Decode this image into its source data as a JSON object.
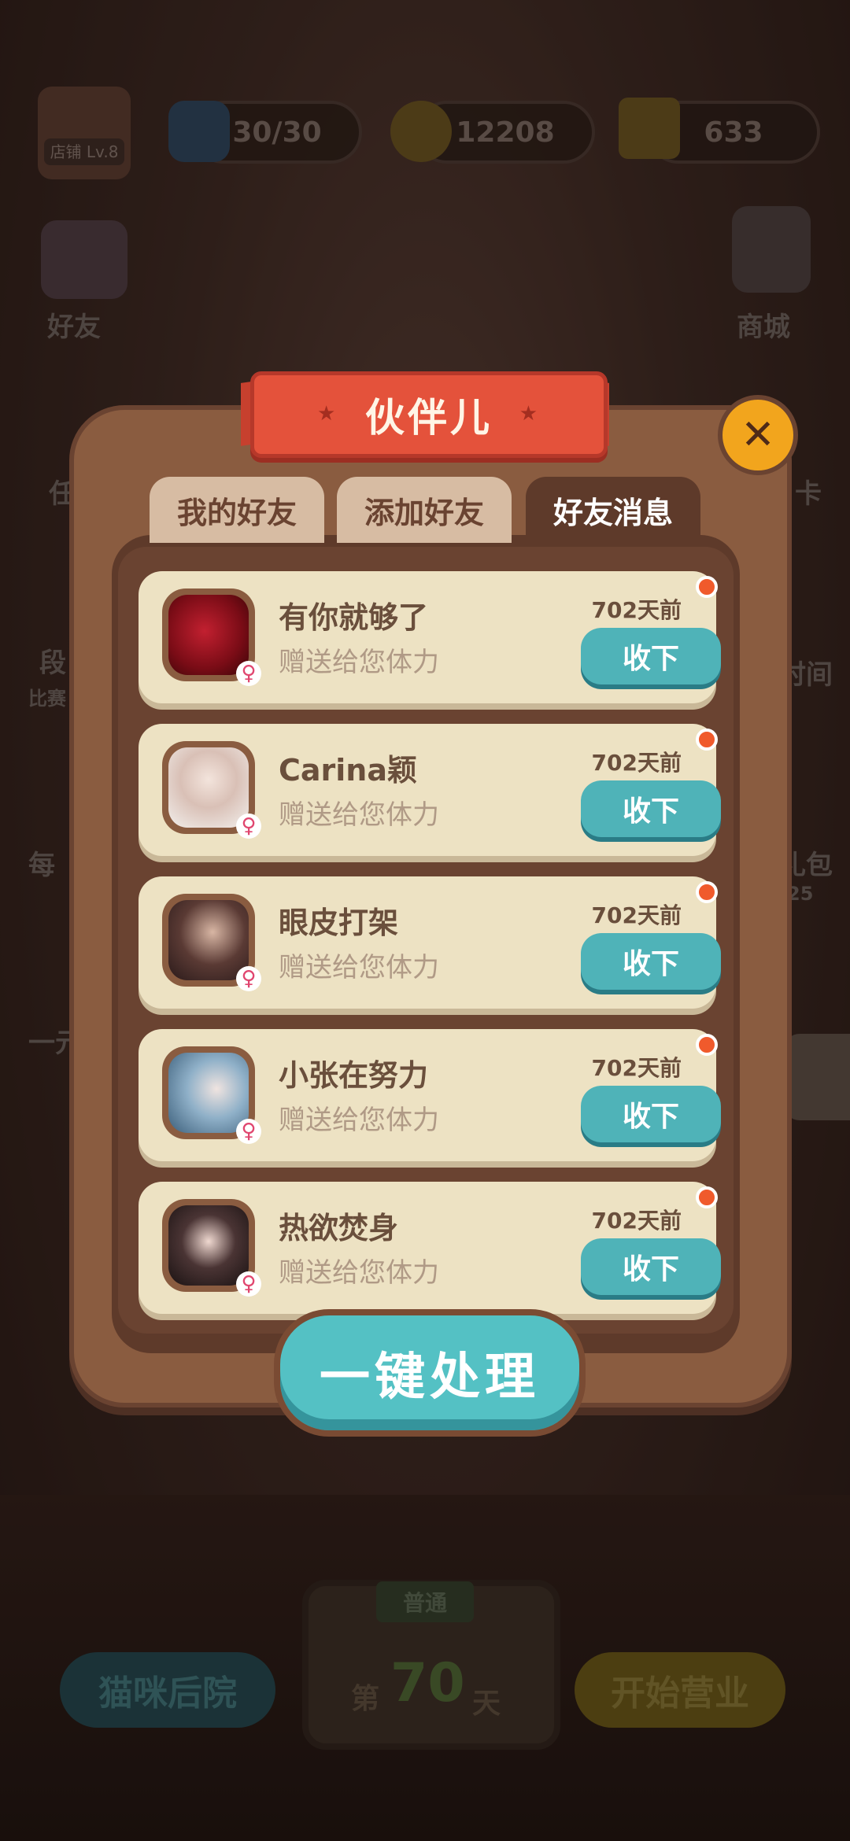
{
  "hud": {
    "shop_level": "店铺 Lv.8",
    "stamina": "30/30",
    "coins": "12208",
    "stars": "633"
  },
  "side_menu": {
    "friends_label": "好友",
    "mall_label": "商城",
    "left_partial_2": "任",
    "left_partial_3": "段",
    "left_partial_3_sub": "比赛",
    "left_partial_4": "每",
    "left_partial_5": "一元",
    "right_partial_2": "卡",
    "right_partial_3": "时间",
    "right_partial_4": "礼包",
    "right_partial_4_sub": "25"
  },
  "bottom": {
    "backyard_label": "猫咪后院",
    "mode_tag": "普通",
    "day_prefix": "第",
    "day_number": "70",
    "day_suffix": "天",
    "start_label": "开始营业"
  },
  "dialog": {
    "title": "伙伴儿",
    "tabs": [
      {
        "label": "我的好友"
      },
      {
        "label": "添加好友"
      },
      {
        "label": "好友消息"
      }
    ],
    "messages": [
      {
        "name": "有你就够了",
        "message": "赠送给您体力",
        "time": "702天前",
        "button": "收下",
        "gender": "♀"
      },
      {
        "name": "Carina颖",
        "message": "赠送给您体力",
        "time": "702天前",
        "button": "收下",
        "gender": "♀"
      },
      {
        "name": "眼皮打架",
        "message": "赠送给您体力",
        "time": "702天前",
        "button": "收下",
        "gender": "♀"
      },
      {
        "name": "小张在努力",
        "message": "赠送给您体力",
        "time": "702天前",
        "button": "收下",
        "gender": "♀"
      },
      {
        "name": "热欲焚身",
        "message": "赠送给您体力",
        "time": "702天前",
        "button": "收下",
        "gender": "♀"
      }
    ],
    "close_glyph": "✕",
    "action_button": "一键处理"
  },
  "colors": {
    "accent_teal": "#4fb3b8",
    "ribbon_red": "#e4523b",
    "close_orange": "#f2a51d",
    "notify_dot": "#f05a2c"
  }
}
